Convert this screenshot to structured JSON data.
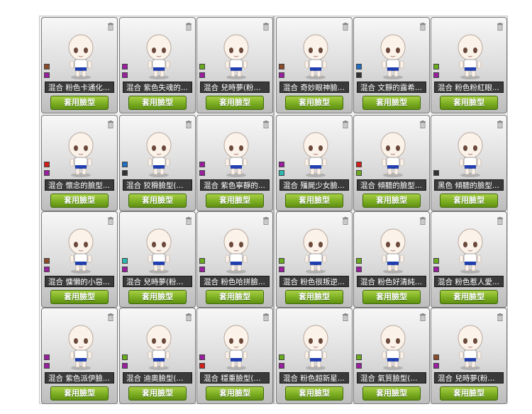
{
  "apply_label": "套用臉型",
  "grid": [
    {
      "name": "混合  粉色卡通化...",
      "colors": [
        "#8b4a2a",
        "#9a1fa0"
      ]
    },
    {
      "name": "混合  紫色失魂的...",
      "colors": [
        "#9a1fa0",
        "#9a1fa0"
      ]
    },
    {
      "name": "混合  兒時夢(粉...",
      "colors": [
        "#6aaa1e",
        "#9a1fa0"
      ]
    },
    {
      "name": "混合  奇妙眼神臉...",
      "colors": [
        "#8b4a2a",
        "#9a1fa0"
      ]
    },
    {
      "name": "混合  文靜的露希...",
      "colors": [
        "#1e6fc0",
        "#333333"
      ]
    },
    {
      "name": "混合  粉色粉紅眼...",
      "colors": [
        "#6aaa1e",
        "#9a1fa0"
      ]
    },
    {
      "name": "混合  懷念的臉型...",
      "colors": [
        "#d0201a",
        "#9a1fa0"
      ]
    },
    {
      "name": "混合  狡猾臉型(...",
      "colors": [
        "#1e6fc0",
        "#333333"
      ]
    },
    {
      "name": "混合  紫色寧靜的...",
      "colors": [
        "#9a1fa0",
        "#9a1fa0"
      ]
    },
    {
      "name": "混合  殭屍少女臉...",
      "colors": [
        "#9a1fa0",
        "#2ab8b0"
      ]
    },
    {
      "name": "混合  傾聽的臉型...",
      "colors": [
        "#d0201a",
        "#6aaa1e"
      ]
    },
    {
      "name": "黑色  傾聽的臉型...",
      "colors": [
        "#333333"
      ]
    },
    {
      "name": "混合  慵懶的小惡...",
      "colors": [
        "#8b4a2a",
        "#9a1fa0"
      ]
    },
    {
      "name": "混合  兒時夢(粉...",
      "colors": [
        "#2ab8b0",
        "#9a1fa0"
      ]
    },
    {
      "name": "混合  粉色哈拼臉...",
      "colors": [
        "#6aaa1e",
        "#9a1fa0"
      ]
    },
    {
      "name": "混合  粉色很叛逆...",
      "colors": [
        "#6aaa1e",
        "#9a1fa0"
      ]
    },
    {
      "name": "混合  粉色好清純...",
      "colors": [
        "#6aaa1e",
        "#9a1fa0"
      ]
    },
    {
      "name": "混合  粉色惹人愛...",
      "colors": [
        "#6aaa1e",
        "#9a1fa0"
      ]
    },
    {
      "name": "混合  紫色派伊臉...",
      "colors": [
        "#9a1fa0",
        "#9a1fa0"
      ]
    },
    {
      "name": "混合  迪奧臉型(...",
      "colors": [
        "#6aaa1e",
        "#9a1fa0"
      ]
    },
    {
      "name": "混合  穩重臉型(...",
      "colors": [
        "#9a1fa0",
        "#d0201a"
      ]
    },
    {
      "name": "混合  粉色超新星...",
      "colors": [
        "#6aaa1e",
        "#9a1fa0"
      ]
    },
    {
      "name": "混合  氣質臉型(...",
      "colors": [
        "#6aaa1e",
        "#9a1fa0"
      ]
    },
    {
      "name": "混合  兒時夢(粉...",
      "colors": [
        "#8b4a2a",
        "#9a1fa0"
      ]
    }
  ]
}
